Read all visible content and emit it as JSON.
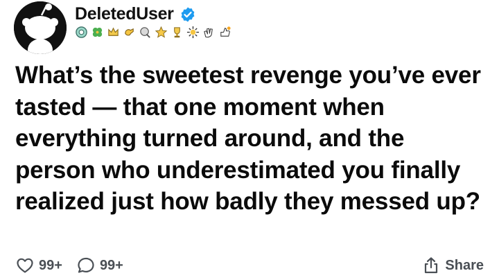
{
  "post": {
    "author": {
      "username": "DeletedUser",
      "verified": true,
      "avatar": "snoo-avatar-icon"
    },
    "badges": [
      "award-badge-icon",
      "clover-badge-icon",
      "crown-badge-icon",
      "hand-badge-icon",
      "award-badge-icon",
      "star-badge-icon",
      "trophy-badge-icon",
      "sparkle-badge-icon",
      "clap-badge-icon",
      "thumb-badge-icon"
    ],
    "text": "What’s the sweetest revenge you’ve ever tasted — that one moment when everything turned around, and the person who underestimated you finally realized just how badly they messed up?",
    "actions": {
      "likes": "99+",
      "comments": "99+",
      "share_label": "Share"
    }
  },
  "colors": {
    "verified": "#1d9bf0",
    "action_text": "#4a4f55",
    "text": "#0b0b0b"
  }
}
